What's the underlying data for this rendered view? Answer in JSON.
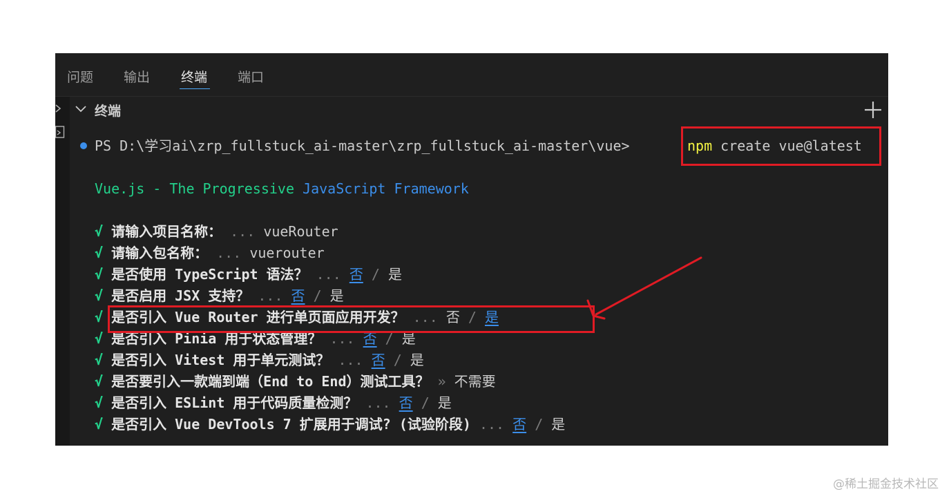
{
  "tabs": [
    {
      "label": "问题",
      "active": false
    },
    {
      "label": "输出",
      "active": false
    },
    {
      "label": "终端",
      "active": true
    },
    {
      "label": "端口",
      "active": false
    }
  ],
  "section": {
    "title": "终端"
  },
  "terminal": {
    "prompt_prefix": "PS",
    "prompt_path": "D:\\学习ai\\zrp_fullstuck_ai-master\\zrp_fullstuck_ai-master\\vue>",
    "command_name": "npm",
    "command_args": "create vue@latest",
    "banner_part1": "Vue.js - The Progressive ",
    "banner_part2": "JavaScript Framework",
    "check": "√",
    "dots": "...",
    "separator": "/",
    "lines": [
      {
        "question": "请输入项目名称：",
        "answer": "vueRouter"
      },
      {
        "question": "请输入包名称：",
        "answer": "vuerouter"
      },
      {
        "question": "是否使用 TypeScript 语法？",
        "no": "否",
        "yes": "是",
        "selected": "no"
      },
      {
        "question": "是否启用 JSX 支持？",
        "no": "否",
        "yes": "是",
        "selected": "no"
      },
      {
        "question": "是否引入 Vue Router 进行单页面应用开发？",
        "no": "否",
        "yes": "是",
        "selected": "yes"
      },
      {
        "question": "是否引入 Pinia 用于状态管理？",
        "no": "否",
        "yes": "是",
        "selected": "no"
      },
      {
        "question": "是否引入 Vitest 用于单元测试？",
        "no": "否",
        "yes": "是",
        "selected": "no"
      },
      {
        "question": "是否要引入一款端到端（End to End）测试工具？",
        "marker": "»",
        "answer": "不需要"
      },
      {
        "question": "是否引入 ESLint 用于代码质量检测？",
        "no": "否",
        "yes": "是",
        "selected": "no"
      },
      {
        "question": "是否引入 Vue DevTools 7 扩展用于调试? (试验阶段)",
        "no": "否",
        "yes": "是",
        "selected": "no"
      }
    ]
  },
  "watermark": "@稀土掘金技术社区",
  "colors": {
    "panel_bg": "#1f1f1f",
    "highlight_red": "#e01b24",
    "accent_blue": "#3b8eea",
    "green": "#23d18b",
    "yellow": "#f5f543"
  }
}
